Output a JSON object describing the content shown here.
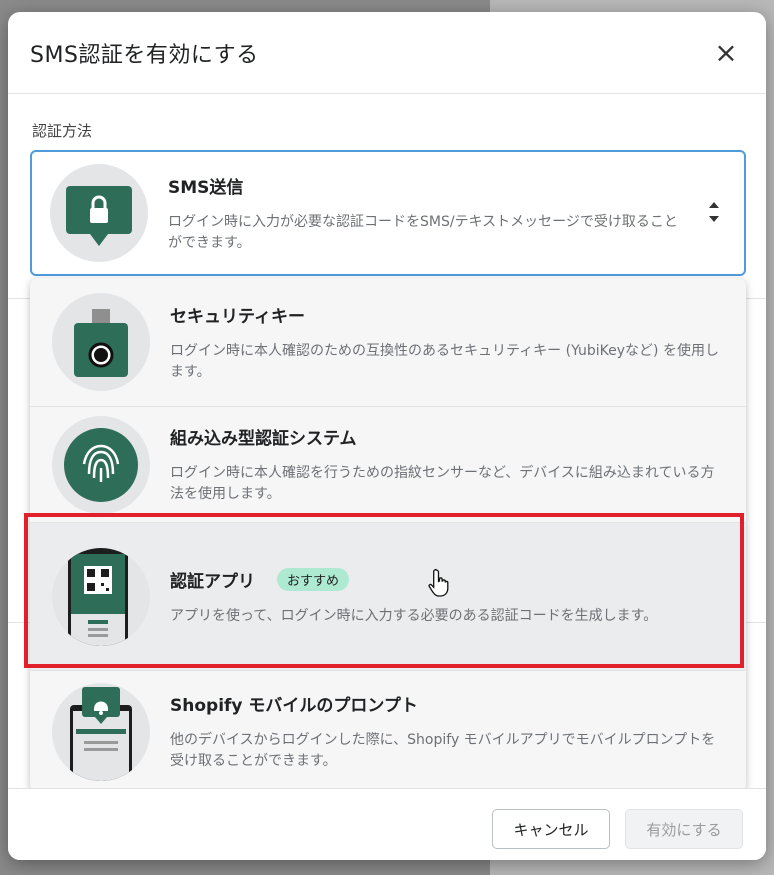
{
  "modal": {
    "title": "SMS認証を有効にする",
    "section_label": "認証方法"
  },
  "selected": {
    "title": "SMS送信",
    "desc": "ログイン時に入力が必要な認証コードをSMS/テキストメッセージで受け取ることができます。",
    "icon": "sms-lock-icon"
  },
  "options": [
    {
      "title": "セキュリティキー",
      "desc": "ログイン時に本人確認のための互換性のあるセキュリティキー (YubiKeyなど) を使用します。",
      "icon": "security-key-icon"
    },
    {
      "title": "組み込み型認証システム",
      "desc": "ログイン時に本人確認を行うための指紋センサーなど、デバイスに組み込まれている方法を使用します。",
      "icon": "fingerprint-icon"
    },
    {
      "title": "認証アプリ",
      "badge": "おすすめ",
      "desc": "アプリを使って、ログイン時に入力する必要のある認証コードを生成します。",
      "icon": "qr-phone-icon"
    },
    {
      "title": "Shopify モバイルのプロンプト",
      "desc": "他のデバイスからログインした際に、Shopify モバイルアプリでモバイルプロンプトを受け取ることができます。",
      "icon": "mobile-bell-icon"
    }
  ],
  "footer": {
    "cancel_label": "キャンセル",
    "enable_label": "有効にする"
  },
  "colors": {
    "accent_green": "#2e6e58",
    "badge_green": "#aee9d1",
    "focus_blue": "#4f9bdc",
    "highlight_red": "#e2202c"
  }
}
